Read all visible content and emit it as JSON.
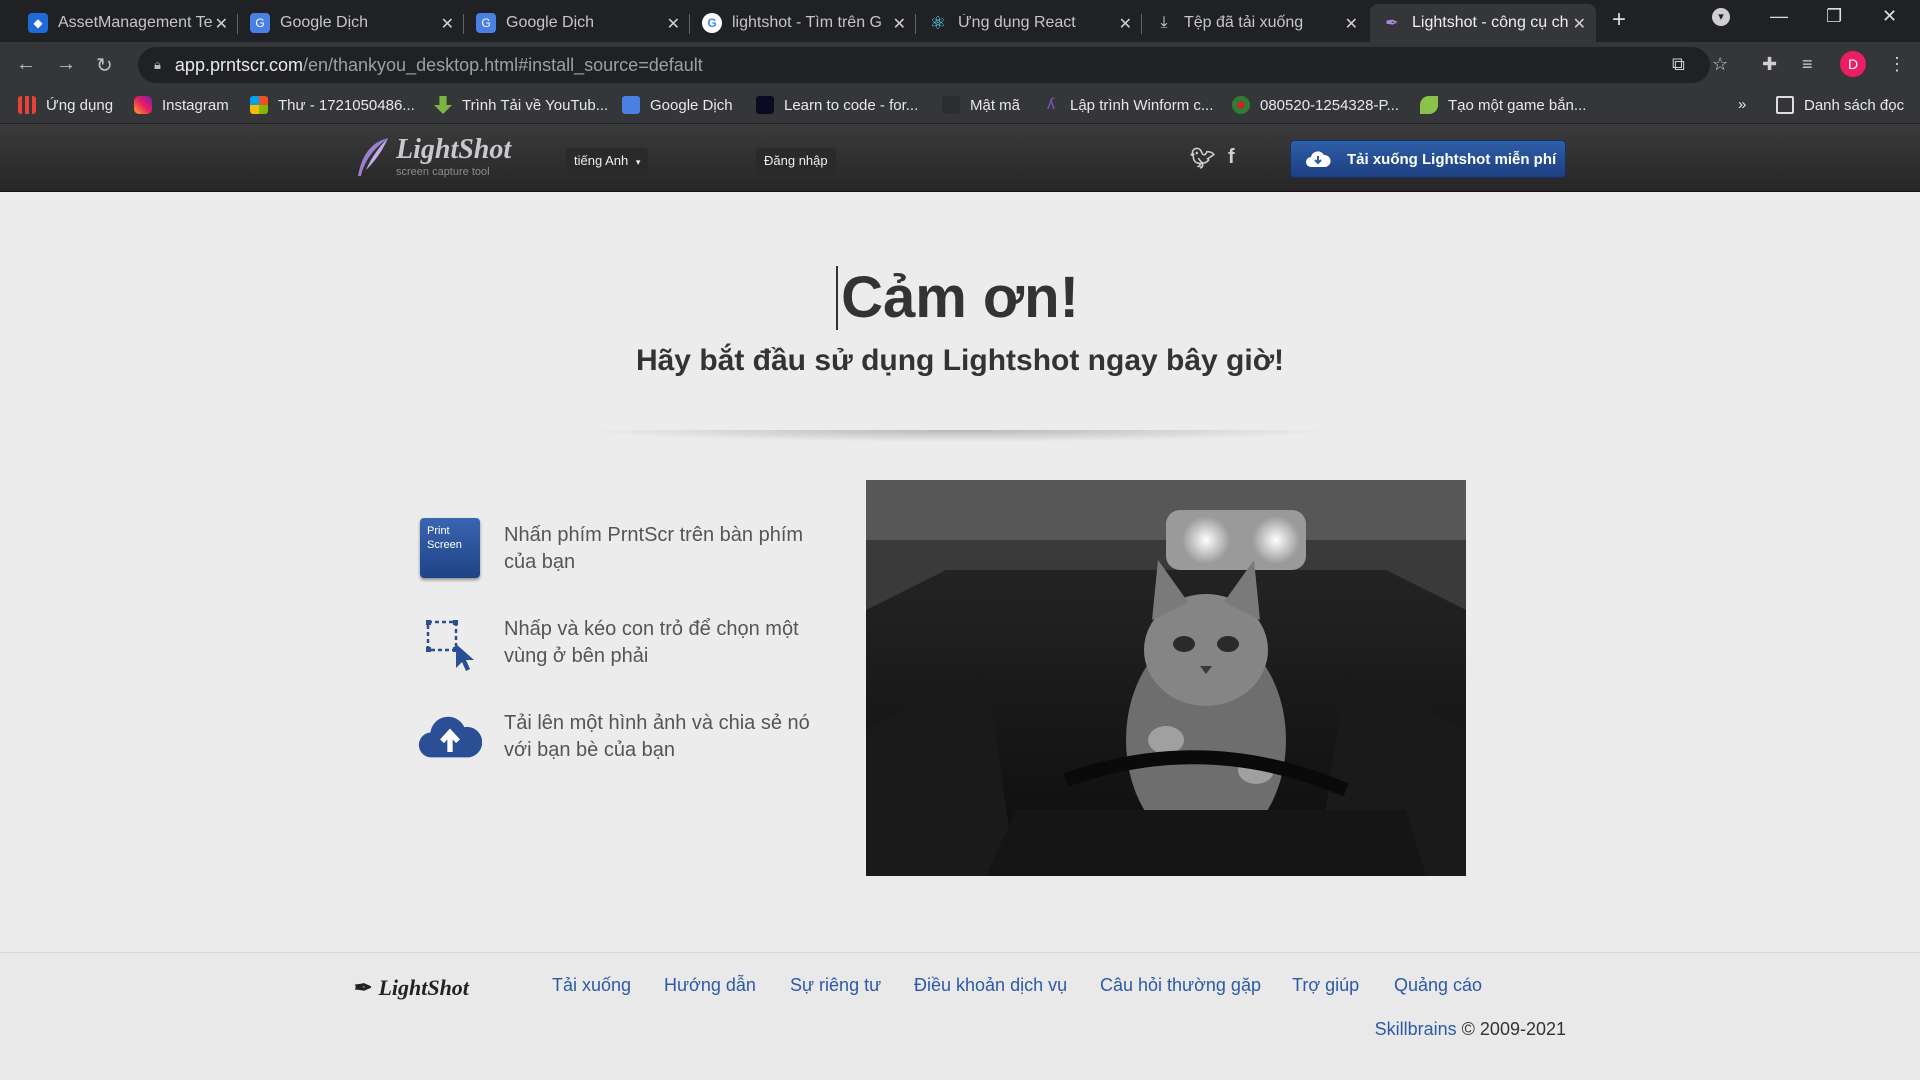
{
  "browser": {
    "tabs": [
      {
        "title": "AssetManagement Te",
        "favicon": "azure-devops-icon"
      },
      {
        "title": "Google Dịch",
        "favicon": "google-translate-icon"
      },
      {
        "title": "Google Dịch",
        "favicon": "google-translate-icon"
      },
      {
        "title": "lightshot - Tìm trên G",
        "favicon": "google-icon"
      },
      {
        "title": "Ứng dụng React",
        "favicon": "react-icon"
      },
      {
        "title": "Tệp đã tải xuống",
        "favicon": "download-icon"
      },
      {
        "title": "Lightshot - công cụ ch",
        "favicon": "lightshot-feather-icon",
        "active": true
      }
    ],
    "url_host": "app.prntscr.com",
    "url_path": "/en/thankyou_desktop.html#install_source=default",
    "profile_initial": "D",
    "bookmarks": [
      {
        "label": "Ứng dụng",
        "icon": "apps-grid-icon"
      },
      {
        "label": "Instagram",
        "icon": "instagram-icon"
      },
      {
        "label": "Thư - 1721050486...",
        "icon": "microsoft-icon"
      },
      {
        "label": "Trình Tải về YouTub...",
        "icon": "download-arrow-icon"
      },
      {
        "label": "Google Dịch",
        "icon": "google-translate-icon"
      },
      {
        "label": "Learn to code - for...",
        "icon": "freecodecamp-icon"
      },
      {
        "label": "Mật mã",
        "icon": "page-icon"
      },
      {
        "label": "Lập trình Winform c...",
        "icon": "page-icon"
      },
      {
        "label": "080520-1254328-P...",
        "icon": "tree-icon"
      },
      {
        "label": "Tạo một game bắn...",
        "icon": "leaf-icon"
      }
    ],
    "bookmarks_overflow": "»",
    "reading_list": "Danh sách đọc"
  },
  "site": {
    "logo_name": "LightShot",
    "logo_tagline": "screen capture tool",
    "language": "tiếng Anh",
    "login": "Đăng nhập",
    "download_button": "Tải xuống Lightshot miễn phí",
    "brand_color": "#2c5aa8"
  },
  "main": {
    "title": "Cảm ơn!",
    "subtitle": "Hãy bắt đầu sử dụng Lightshot ngay bây giờ!",
    "print_key_label_1": "Print",
    "print_key_label_2": "Screen",
    "steps": [
      {
        "text": "Nhấn phím PrntScr trên bàn phím của bạn",
        "icon": "print-screen-key-icon"
      },
      {
        "text": "Nhấp và kéo con trỏ để chọn một vùng ở bên phải",
        "icon": "selection-cursor-icon"
      },
      {
        "text": "Tải lên một hình ảnh và chia sẻ nó với bạn bè của bạn",
        "icon": "cloud-upload-icon"
      }
    ]
  },
  "footer": {
    "logo": "LightShot",
    "links": [
      "Tải xuống",
      "Hướng dẫn",
      "Sự riêng tư",
      "Điều khoản dịch vụ",
      "Câu hỏi thường gặp",
      "Trợ giúp",
      "Quảng cáo"
    ],
    "company": "Skillbrains",
    "copyright": "© 2009-2021"
  }
}
